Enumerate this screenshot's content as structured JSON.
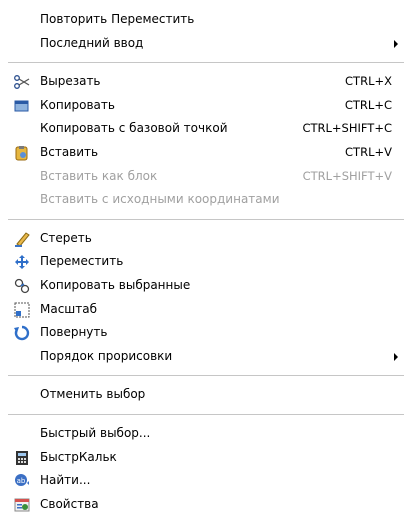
{
  "menu": {
    "items": [
      {
        "label": "Повторить Переместить",
        "shortcut": "",
        "icon": "",
        "disabled": false,
        "submenu": false
      },
      {
        "label": "Последний ввод",
        "shortcut": "",
        "icon": "",
        "disabled": false,
        "submenu": true
      },
      {
        "separator": true
      },
      {
        "label": "Вырезать",
        "shortcut": "CTRL+X",
        "icon": "scissors-icon",
        "disabled": false,
        "submenu": false
      },
      {
        "label": "Копировать",
        "shortcut": "CTRL+C",
        "icon": "copy-icon",
        "disabled": false,
        "submenu": false
      },
      {
        "label": "Копировать с базовой точкой",
        "shortcut": "CTRL+SHIFT+C",
        "icon": "",
        "disabled": false,
        "submenu": false
      },
      {
        "label": "Вставить",
        "shortcut": "CTRL+V",
        "icon": "paste-icon",
        "disabled": false,
        "submenu": false
      },
      {
        "label": "Вставить как блок",
        "shortcut": "CTRL+SHIFT+V",
        "icon": "",
        "disabled": true,
        "submenu": false
      },
      {
        "label": "Вставить с исходными координатами",
        "shortcut": "",
        "icon": "",
        "disabled": true,
        "submenu": false
      },
      {
        "separator": true
      },
      {
        "label": "Стереть",
        "shortcut": "",
        "icon": "eraser-icon",
        "disabled": false,
        "submenu": false
      },
      {
        "label": "Переместить",
        "shortcut": "",
        "icon": "move-icon",
        "disabled": false,
        "submenu": false
      },
      {
        "label": "Копировать выбранные",
        "shortcut": "",
        "icon": "copy-selection-icon",
        "disabled": false,
        "submenu": false
      },
      {
        "label": "Масштаб",
        "shortcut": "",
        "icon": "scale-icon",
        "disabled": false,
        "submenu": false
      },
      {
        "label": "Повернуть",
        "shortcut": "",
        "icon": "rotate-icon",
        "disabled": false,
        "submenu": false
      },
      {
        "label": "Порядок прорисовки",
        "shortcut": "",
        "icon": "",
        "disabled": false,
        "submenu": true
      },
      {
        "separator": true
      },
      {
        "label": "Отменить выбор",
        "shortcut": "",
        "icon": "",
        "disabled": false,
        "submenu": false
      },
      {
        "separator": true
      },
      {
        "label": "Быстрый выбор...",
        "shortcut": "",
        "icon": "",
        "disabled": false,
        "submenu": false
      },
      {
        "label": "БыстрКальк",
        "shortcut": "",
        "icon": "calculator-icon",
        "disabled": false,
        "submenu": false
      },
      {
        "label": "Найти...",
        "shortcut": "",
        "icon": "find-icon",
        "disabled": false,
        "submenu": false
      },
      {
        "label": "Свойства",
        "shortcut": "",
        "icon": "properties-icon",
        "disabled": false,
        "submenu": false
      }
    ]
  }
}
